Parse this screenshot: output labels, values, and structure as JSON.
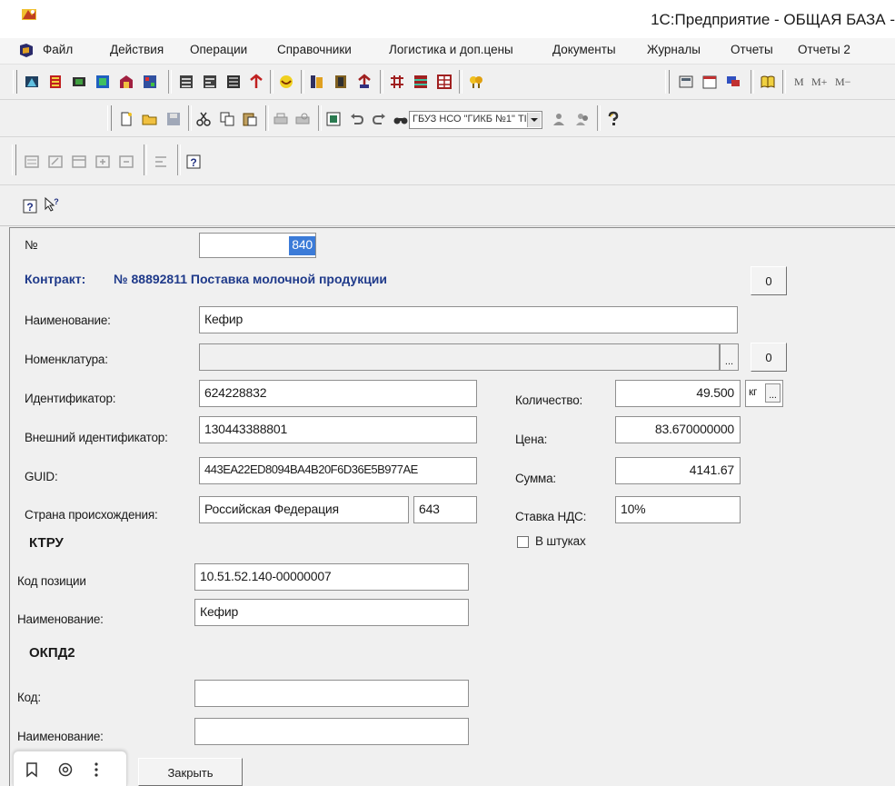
{
  "window": {
    "title": "1С:Предприятие - ОБЩАЯ БАЗА -"
  },
  "menu": [
    "Файл",
    "Действия",
    "Операции",
    "Справочники",
    "Логистика и доп.цены",
    "Документы",
    "Журналы",
    "Отчеты",
    "Отчеты 2"
  ],
  "toolbar_memory": [
    "M",
    "M+",
    "M−"
  ],
  "toolbar_combo": "ГБУЗ НСО \"ГИКБ №1\" ТI",
  "form": {
    "number": {
      "label": "№",
      "value": "840"
    },
    "contract": {
      "label": "Контракт:",
      "value": "№ 88892811 Поставка молочной продукции"
    },
    "zero_button": "0",
    "name": {
      "label": "Наименование:",
      "value": "Кефир"
    },
    "nomenclature": {
      "label": "Номенклатура:",
      "value": ""
    },
    "ellipsis": "...",
    "identifier": {
      "label": "Идентификатор:",
      "value": "624228832"
    },
    "ext_identifier": {
      "label": "Внешний идентификатор:",
      "value": "130443388801"
    },
    "guid": {
      "label": "GUID:",
      "value": "443EA22ED8094BA4B20F6D36E5B977AE"
    },
    "country": {
      "label": "Страна происхождения:",
      "value": "Российская Федерация",
      "code": "643"
    },
    "quantity": {
      "label": "Количество:",
      "value": "49.500",
      "unit": "кг"
    },
    "price": {
      "label": "Цена:",
      "value": "83.670000000"
    },
    "sum": {
      "label": "Сумма:",
      "value": "4141.67"
    },
    "vat": {
      "label": "Ставка НДС:",
      "value": "10%"
    },
    "in_pieces": {
      "label": "В штуках",
      "checked": false
    },
    "ktru": {
      "heading": "КТРУ",
      "code": {
        "label": "Код позиции",
        "value": "10.51.52.140-00000007"
      },
      "name": {
        "label": "Наименование:",
        "value": "Кефир"
      }
    },
    "okpd2": {
      "heading": "ОКПД2",
      "code": {
        "label": "Код:",
        "value": ""
      },
      "name": {
        "label": "Наименование:",
        "value": ""
      }
    },
    "close_button": "Закрыть"
  },
  "colors": {
    "contract_text": "#1f3a8a",
    "selection": "#3b7bd8"
  }
}
